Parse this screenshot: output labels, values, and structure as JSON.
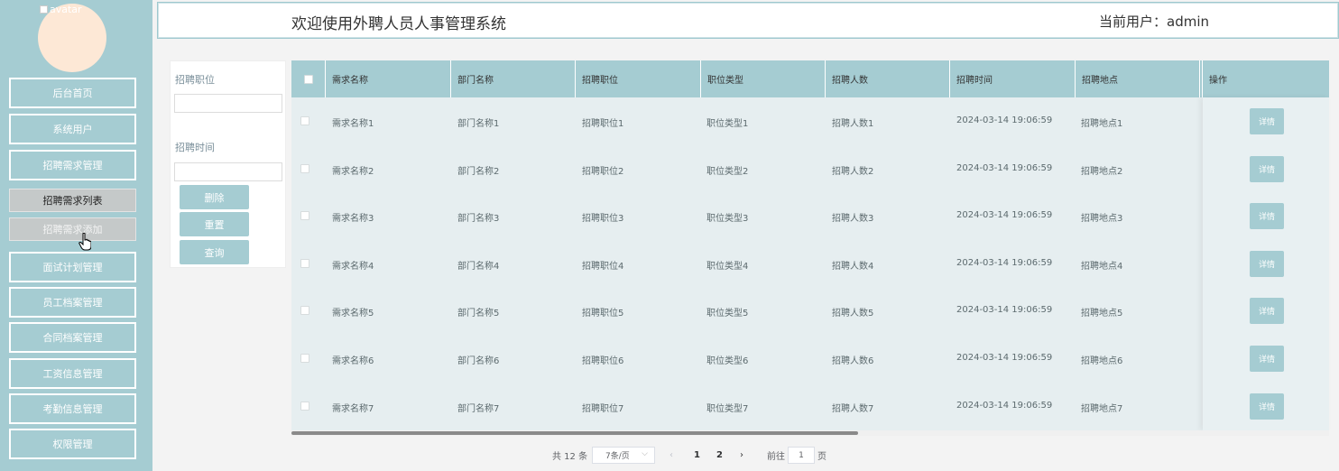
{
  "sidebar": {
    "avatar_alt": "avatar",
    "items": [
      {
        "label": "后台首页"
      },
      {
        "label": "系统用户"
      },
      {
        "label": "招聘需求管理"
      },
      {
        "label": "面试计划管理"
      },
      {
        "label": "员工档案管理"
      },
      {
        "label": "合同档案管理"
      },
      {
        "label": "工资信息管理"
      },
      {
        "label": "考勤信息管理"
      },
      {
        "label": "权限管理"
      }
    ],
    "submenu": [
      {
        "label": "招聘需求列表"
      },
      {
        "label": "招聘需求添加"
      }
    ]
  },
  "header": {
    "title": "欢迎使用外聘人员人事管理系统",
    "user": "当前用户：admin"
  },
  "filters": {
    "position_label": "招聘职位",
    "position_value": "",
    "time_label": "招聘时间",
    "time_value": "",
    "delete_label": "删除",
    "reset_label": "重置",
    "search_label": "查询"
  },
  "table": {
    "columns": [
      "需求名称",
      "部门名称",
      "招聘职位",
      "职位类型",
      "招聘人数",
      "招聘时间",
      "招聘地点",
      "操作"
    ],
    "rows": [
      [
        "需求名称1",
        "部门名称1",
        "招聘职位1",
        "职位类型1",
        "招聘人数1",
        "2024-03-14 19:06:59",
        "招聘地点1"
      ],
      [
        "需求名称2",
        "部门名称2",
        "招聘职位2",
        "职位类型2",
        "招聘人数2",
        "2024-03-14 19:06:59",
        "招聘地点2"
      ],
      [
        "需求名称3",
        "部门名称3",
        "招聘职位3",
        "职位类型3",
        "招聘人数3",
        "2024-03-14 19:06:59",
        "招聘地点3"
      ],
      [
        "需求名称4",
        "部门名称4",
        "招聘职位4",
        "职位类型4",
        "招聘人数4",
        "2024-03-14 19:06:59",
        "招聘地点4"
      ],
      [
        "需求名称5",
        "部门名称5",
        "招聘职位5",
        "职位类型5",
        "招聘人数5",
        "2024-03-14 19:06:59",
        "招聘地点5"
      ],
      [
        "需求名称6",
        "部门名称6",
        "招聘职位6",
        "职位类型6",
        "招聘人数6",
        "2024-03-14 19:06:59",
        "招聘地点6"
      ],
      [
        "需求名称7",
        "部门名称7",
        "招聘职位7",
        "职位类型7",
        "招聘人数7",
        "2024-03-14 19:06:59",
        "招聘地点7"
      ]
    ],
    "detail_label": "详情"
  },
  "pagination": {
    "total": "共 12 条",
    "page_size": "7条/页",
    "pages": [
      "1",
      "2"
    ],
    "goto_prefix": "前往",
    "goto_value": "1",
    "goto_suffix": "页"
  },
  "colors": {
    "accent": "#a5ccd2",
    "table_bg": "#e6eef0"
  }
}
